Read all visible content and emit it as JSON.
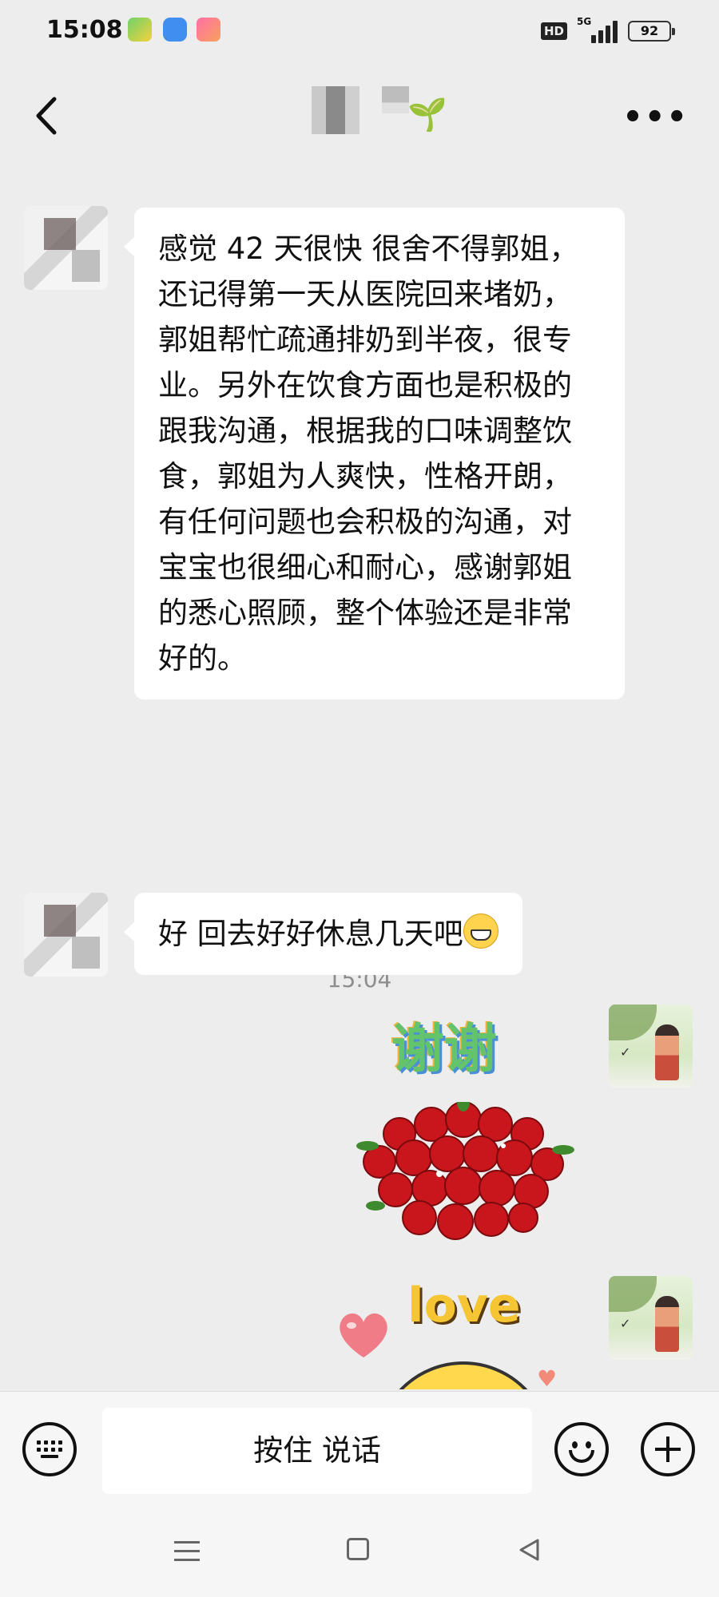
{
  "status_bar": {
    "time": "15:08",
    "hd_label": "HD",
    "network_label": "5G",
    "battery": "92",
    "app_icons": [
      "video-app-icon",
      "blue-app-icon",
      "pink-app-icon"
    ]
  },
  "header": {
    "back_icon": "chevron-left-icon",
    "title_emoji": "🌱",
    "more_icon": "more-dots-icon"
  },
  "messages": [
    {
      "side": "left",
      "text": "感觉 42 天很快 很舍不得郭姐，还记得第一天从医院回来堵奶，郭姐帮忙疏通排奶到半夜，很专业。另外在饮食方面也是积极的跟我沟通，根据我的口味调整饮食，郭姐为人爽快，性格开朗，有任何问题也会积极的沟通，对宝宝也很细心和耐心，感谢郭姐的悉心照顾，整个体验还是非常好的。"
    },
    {
      "type": "timestamp",
      "text": "15:04"
    },
    {
      "side": "left",
      "text": "好 回去好好休息几天吧"
    },
    {
      "side": "right",
      "type": "sticker",
      "text": "谢谢",
      "icon": "rose-bouquet-sticker"
    },
    {
      "side": "right",
      "type": "sticker",
      "text": "love",
      "icon": "love-smiley-sticker"
    }
  ],
  "input_bar": {
    "keyboard_icon": "keyboard-icon",
    "hold_to_talk": "按住 说话",
    "emoji_icon": "smiley-icon",
    "plus_icon": "plus-icon"
  },
  "nav_bar": {
    "icons": [
      "menu-icon",
      "home-square-icon",
      "back-triangle-icon"
    ]
  },
  "colors": {
    "background": "#ededed",
    "bubble": "#ffffff",
    "timestamp": "#8d8d8d"
  }
}
